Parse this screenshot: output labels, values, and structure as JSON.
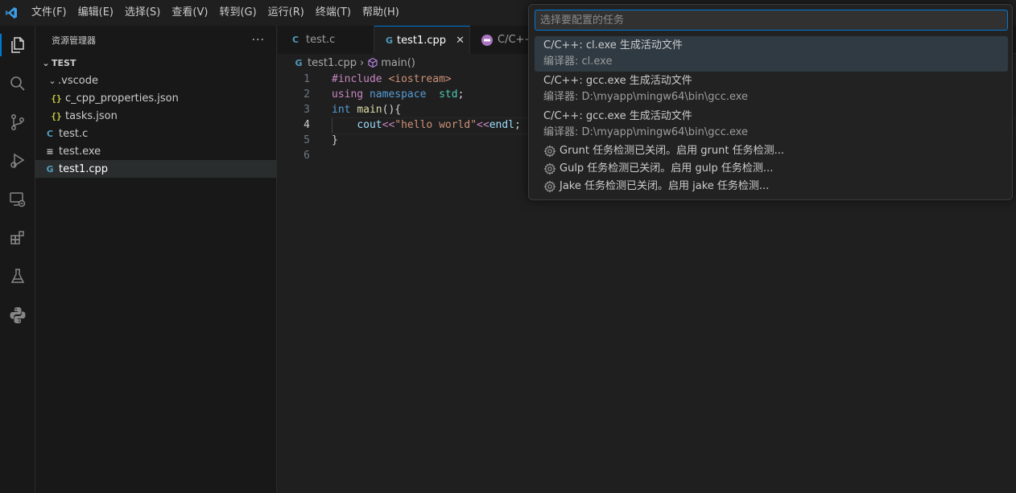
{
  "titlebar": {
    "menu": [
      "文件(F)",
      "编辑(E)",
      "选择(S)",
      "查看(V)",
      "转到(G)",
      "运行(R)",
      "终端(T)",
      "帮助(H)"
    ]
  },
  "sidebar": {
    "title": "资源管理器",
    "more": "···",
    "section": "TEST",
    "tree": {
      "vscode_folder": ".vscode",
      "c_cpp_props": "c_cpp_properties.json",
      "tasks_json": "tasks.json",
      "test_c": "test.c",
      "test_exe": "test.exe",
      "test1_cpp": "test1.cpp"
    }
  },
  "editor": {
    "tabs": [
      {
        "label": "test.c"
      },
      {
        "label": "test1.cpp"
      },
      {
        "label": "C/C++"
      }
    ],
    "breadcrumb": {
      "file": "test1.cpp",
      "symbol": "main()"
    },
    "line_numbers": [
      "1",
      "2",
      "3",
      "4",
      "5",
      "6"
    ]
  },
  "quickpick": {
    "placeholder": "选择要配置的任务",
    "items": [
      {
        "label": "C/C++: cl.exe 生成活动文件",
        "desc": "编译器: cl.exe"
      },
      {
        "label": "C/C++: gcc.exe 生成活动文件",
        "desc": "编译器: D:\\myapp\\mingw64\\bin\\gcc.exe"
      },
      {
        "label": "C/C++: gcc.exe 生成活动文件",
        "desc": "编译器: D:\\myapp\\mingw64\\bin\\gcc.exe"
      }
    ],
    "detectors": [
      "Grunt 任务检测已关闭。启用 grunt 任务检测...",
      "Gulp 任务检测已关闭。启用 gulp 任务检测...",
      "Jake 任务检测已关闭。启用 jake 任务检测..."
    ]
  },
  "colors": {
    "accent": "#0078d4",
    "background": "#1f1f1f",
    "sidebar": "#181818"
  }
}
